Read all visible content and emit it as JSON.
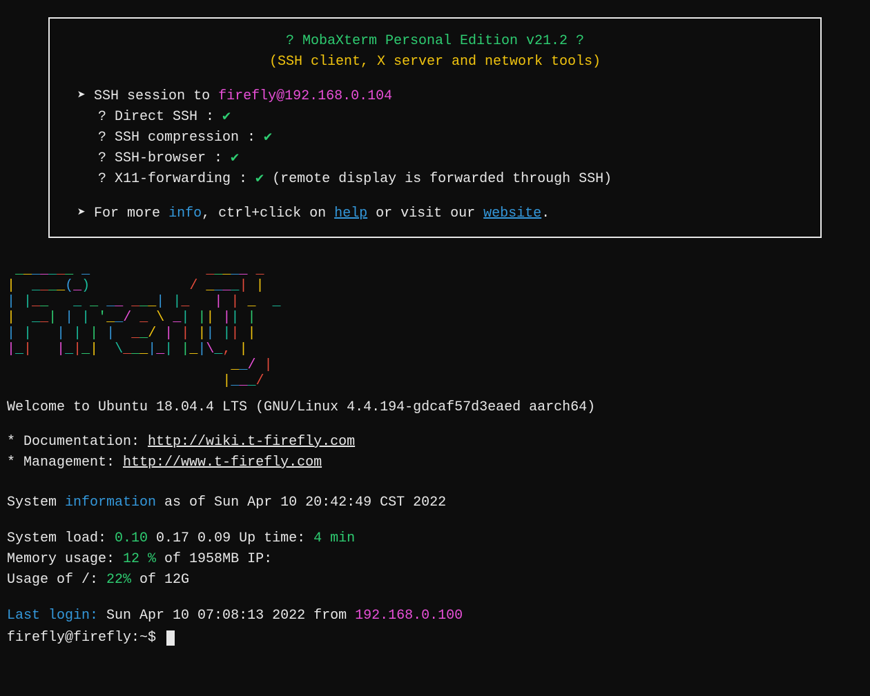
{
  "banner": {
    "title": "? MobaXterm Personal Edition v21.2 ?",
    "subtitle": "(SSH client, X server and network tools)",
    "ssh_prefix": "➤ SSH session to ",
    "ssh_target": "firefly@192.168.0.104",
    "items": [
      {
        "label": "? Direct SSH      :  ",
        "check": "✔",
        "note": ""
      },
      {
        "label": "? SSH compression :  ",
        "check": "✔",
        "note": ""
      },
      {
        "label": "? SSH-browser     :  ",
        "check": "✔",
        "note": ""
      },
      {
        "label": "? X11-forwarding  :  ",
        "check": "✔",
        "note": "  (remote display is forwarded through SSH)"
      }
    ],
    "more_prefix": "➤ For more ",
    "info_word": "info",
    "more_mid1": ", ctrl+click on ",
    "help_word": "help",
    "more_mid2": " or visit our ",
    "website_word": "website",
    "more_end": "."
  },
  "welcome": "Welcome to Ubuntu 18.04.4 LTS (GNU/Linux 4.4.194-gdcaf57d3eaed aarch64)",
  "doc": {
    "label": " * Documentation:  ",
    "url": "http://wiki.t-firefly.com"
  },
  "mgmt": {
    "label": " * Management:     ",
    "url": "http://www.t-firefly.com"
  },
  "sysinfo": {
    "prefix": "System ",
    "info_word": "information",
    "suffix": " as of Sun Apr 10 20:42:49 CST 2022"
  },
  "stats": {
    "load_label": "System load:   ",
    "load_val": "0.10",
    "load_rest": " 0.17 0.09   ",
    "uptime_label": "Up time:       ",
    "uptime_val": "4 min",
    "mem_label": "Memory usage:  ",
    "mem_val": "12 %",
    "mem_rest": " of 1958MB   ",
    "ip_label": "IP:",
    "usage_label": "Usage of /:    ",
    "usage_val": "22%",
    "usage_rest": " of 12G"
  },
  "lastlogin": {
    "label": "Last login:",
    "mid": " Sun Apr 10 07:08:13 2022 from ",
    "ip": "192.168.0.100"
  },
  "prompt": "firefly@firefly:~$ "
}
